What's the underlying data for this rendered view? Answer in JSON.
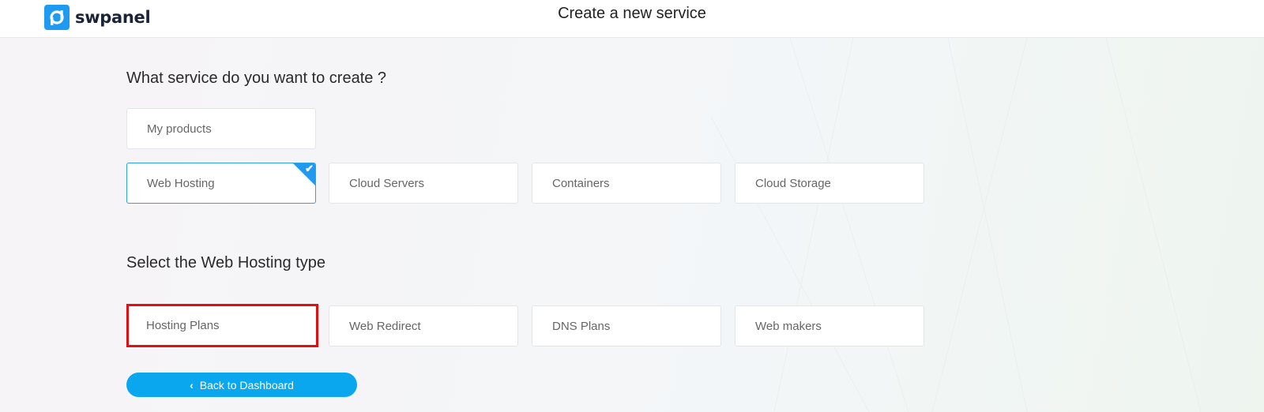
{
  "header": {
    "brand": "swpanel",
    "title": "Create a new service",
    "brand_color": "#1e9bf0"
  },
  "service_section": {
    "title": "What service do you want to create ?",
    "my_products": "My products",
    "options": [
      {
        "label": "Web Hosting",
        "selected": true
      },
      {
        "label": "Cloud Servers",
        "selected": false
      },
      {
        "label": "Containers",
        "selected": false
      },
      {
        "label": "Cloud Storage",
        "selected": false
      }
    ],
    "selected_check": "✔"
  },
  "type_section": {
    "title": "Select the Web Hosting type",
    "options": [
      {
        "label": "Hosting Plans",
        "highlighted": true
      },
      {
        "label": "Web Redirect",
        "highlighted": false
      },
      {
        "label": "DNS Plans",
        "highlighted": false
      },
      {
        "label": "Web makers",
        "highlighted": false
      }
    ]
  },
  "back_button": {
    "label": "Back to Dashboard",
    "icon": "‹",
    "color": "#0aa7ef"
  },
  "highlight_color": "#e01010"
}
